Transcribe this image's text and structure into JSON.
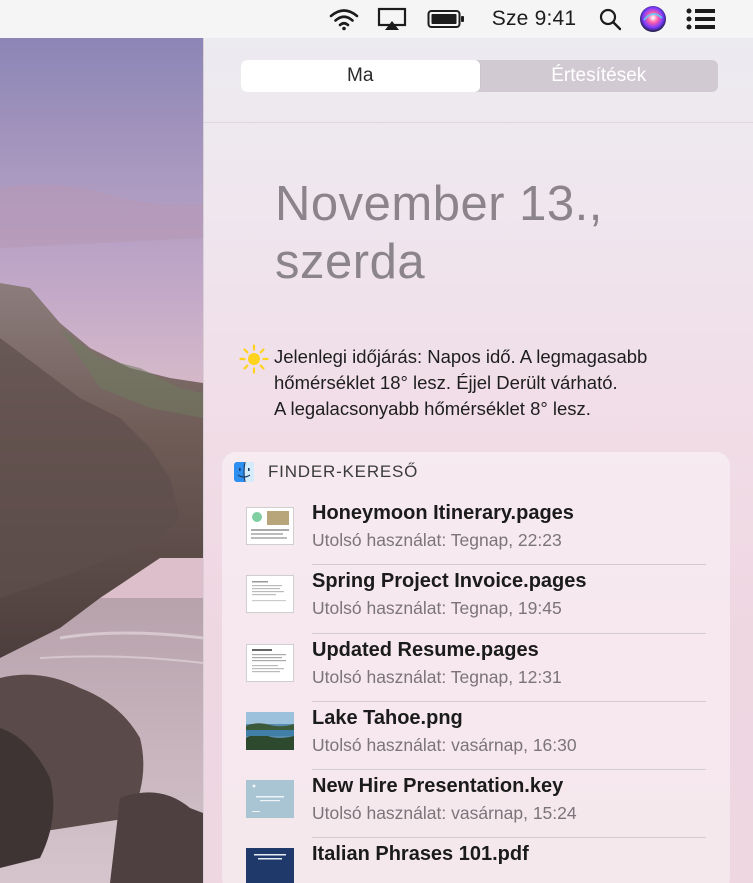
{
  "menubar": {
    "icons": [
      "wifi-icon",
      "airplay-icon",
      "battery-icon",
      "spotlight-search-icon",
      "siri-icon",
      "notification-center-icon"
    ],
    "clock": "Sze 9:41"
  },
  "segment": {
    "today": "Ma",
    "notifications": "Értesítések"
  },
  "date": {
    "line1": "November 13.,",
    "line2": "szerda"
  },
  "weather": {
    "icon": "sun-icon",
    "line1": "Jelenlegi időjárás: Napos idő. A legmagasabb",
    "line2": "hőmérséklet 18° lesz. Éjjel Derült várható.",
    "line3": "A legalacsonyabb hőmérséklet 8° lesz."
  },
  "finder_widget": {
    "icon": "finder-icon",
    "title": "FINDER-KERESŐ",
    "files": [
      {
        "name": "Honeymoon Itinerary.pages",
        "last_used": "Utolsó használat: Tegnap, 22:23"
      },
      {
        "name": "Spring Project Invoice.pages",
        "last_used": "Utolsó használat: Tegnap, 19:45"
      },
      {
        "name": "Updated Resume.pages",
        "last_used": "Utolsó használat: Tegnap, 12:31"
      },
      {
        "name": "Lake Tahoe.png",
        "last_used": "Utolsó használat: vasárnap, 16:30"
      },
      {
        "name": "New Hire Presentation.key",
        "last_used": "Utolsó használat: vasárnap, 15:24"
      },
      {
        "name": "Italian Phrases 101.pdf",
        "last_used": ""
      }
    ]
  },
  "colors": {
    "siri_gradient": [
      "#2fb0ff",
      "#c13cff",
      "#ff4f7a"
    ],
    "panel_tint": "#efd9e4"
  }
}
